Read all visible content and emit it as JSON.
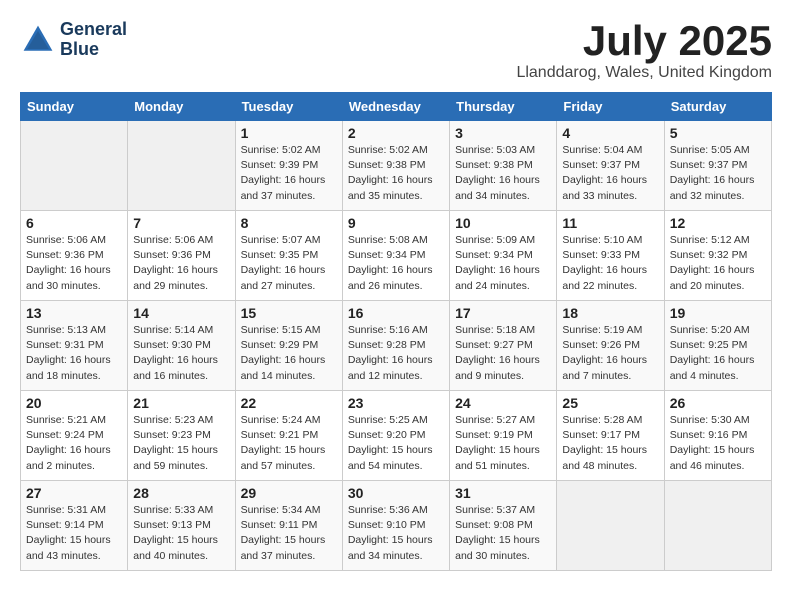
{
  "header": {
    "logo_line1": "General",
    "logo_line2": "Blue",
    "month_title": "July 2025",
    "location": "Llanddarog, Wales, United Kingdom"
  },
  "weekdays": [
    "Sunday",
    "Monday",
    "Tuesday",
    "Wednesday",
    "Thursday",
    "Friday",
    "Saturday"
  ],
  "weeks": [
    [
      {
        "day": "",
        "empty": true
      },
      {
        "day": "",
        "empty": true
      },
      {
        "day": "1",
        "sunrise": "5:02 AM",
        "sunset": "9:39 PM",
        "daylight": "16 hours and 37 minutes."
      },
      {
        "day": "2",
        "sunrise": "5:02 AM",
        "sunset": "9:38 PM",
        "daylight": "16 hours and 35 minutes."
      },
      {
        "day": "3",
        "sunrise": "5:03 AM",
        "sunset": "9:38 PM",
        "daylight": "16 hours and 34 minutes."
      },
      {
        "day": "4",
        "sunrise": "5:04 AM",
        "sunset": "9:37 PM",
        "daylight": "16 hours and 33 minutes."
      },
      {
        "day": "5",
        "sunrise": "5:05 AM",
        "sunset": "9:37 PM",
        "daylight": "16 hours and 32 minutes."
      }
    ],
    [
      {
        "day": "6",
        "sunrise": "5:06 AM",
        "sunset": "9:36 PM",
        "daylight": "16 hours and 30 minutes."
      },
      {
        "day": "7",
        "sunrise": "5:06 AM",
        "sunset": "9:36 PM",
        "daylight": "16 hours and 29 minutes."
      },
      {
        "day": "8",
        "sunrise": "5:07 AM",
        "sunset": "9:35 PM",
        "daylight": "16 hours and 27 minutes."
      },
      {
        "day": "9",
        "sunrise": "5:08 AM",
        "sunset": "9:34 PM",
        "daylight": "16 hours and 26 minutes."
      },
      {
        "day": "10",
        "sunrise": "5:09 AM",
        "sunset": "9:34 PM",
        "daylight": "16 hours and 24 minutes."
      },
      {
        "day": "11",
        "sunrise": "5:10 AM",
        "sunset": "9:33 PM",
        "daylight": "16 hours and 22 minutes."
      },
      {
        "day": "12",
        "sunrise": "5:12 AM",
        "sunset": "9:32 PM",
        "daylight": "16 hours and 20 minutes."
      }
    ],
    [
      {
        "day": "13",
        "sunrise": "5:13 AM",
        "sunset": "9:31 PM",
        "daylight": "16 hours and 18 minutes."
      },
      {
        "day": "14",
        "sunrise": "5:14 AM",
        "sunset": "9:30 PM",
        "daylight": "16 hours and 16 minutes."
      },
      {
        "day": "15",
        "sunrise": "5:15 AM",
        "sunset": "9:29 PM",
        "daylight": "16 hours and 14 minutes."
      },
      {
        "day": "16",
        "sunrise": "5:16 AM",
        "sunset": "9:28 PM",
        "daylight": "16 hours and 12 minutes."
      },
      {
        "day": "17",
        "sunrise": "5:18 AM",
        "sunset": "9:27 PM",
        "daylight": "16 hours and 9 minutes."
      },
      {
        "day": "18",
        "sunrise": "5:19 AM",
        "sunset": "9:26 PM",
        "daylight": "16 hours and 7 minutes."
      },
      {
        "day": "19",
        "sunrise": "5:20 AM",
        "sunset": "9:25 PM",
        "daylight": "16 hours and 4 minutes."
      }
    ],
    [
      {
        "day": "20",
        "sunrise": "5:21 AM",
        "sunset": "9:24 PM",
        "daylight": "16 hours and 2 minutes."
      },
      {
        "day": "21",
        "sunrise": "5:23 AM",
        "sunset": "9:23 PM",
        "daylight": "15 hours and 59 minutes."
      },
      {
        "day": "22",
        "sunrise": "5:24 AM",
        "sunset": "9:21 PM",
        "daylight": "15 hours and 57 minutes."
      },
      {
        "day": "23",
        "sunrise": "5:25 AM",
        "sunset": "9:20 PM",
        "daylight": "15 hours and 54 minutes."
      },
      {
        "day": "24",
        "sunrise": "5:27 AM",
        "sunset": "9:19 PM",
        "daylight": "15 hours and 51 minutes."
      },
      {
        "day": "25",
        "sunrise": "5:28 AM",
        "sunset": "9:17 PM",
        "daylight": "15 hours and 48 minutes."
      },
      {
        "day": "26",
        "sunrise": "5:30 AM",
        "sunset": "9:16 PM",
        "daylight": "15 hours and 46 minutes."
      }
    ],
    [
      {
        "day": "27",
        "sunrise": "5:31 AM",
        "sunset": "9:14 PM",
        "daylight": "15 hours and 43 minutes."
      },
      {
        "day": "28",
        "sunrise": "5:33 AM",
        "sunset": "9:13 PM",
        "daylight": "15 hours and 40 minutes."
      },
      {
        "day": "29",
        "sunrise": "5:34 AM",
        "sunset": "9:11 PM",
        "daylight": "15 hours and 37 minutes."
      },
      {
        "day": "30",
        "sunrise": "5:36 AM",
        "sunset": "9:10 PM",
        "daylight": "15 hours and 34 minutes."
      },
      {
        "day": "31",
        "sunrise": "5:37 AM",
        "sunset": "9:08 PM",
        "daylight": "15 hours and 30 minutes."
      },
      {
        "day": "",
        "empty": true
      },
      {
        "day": "",
        "empty": true
      }
    ]
  ]
}
